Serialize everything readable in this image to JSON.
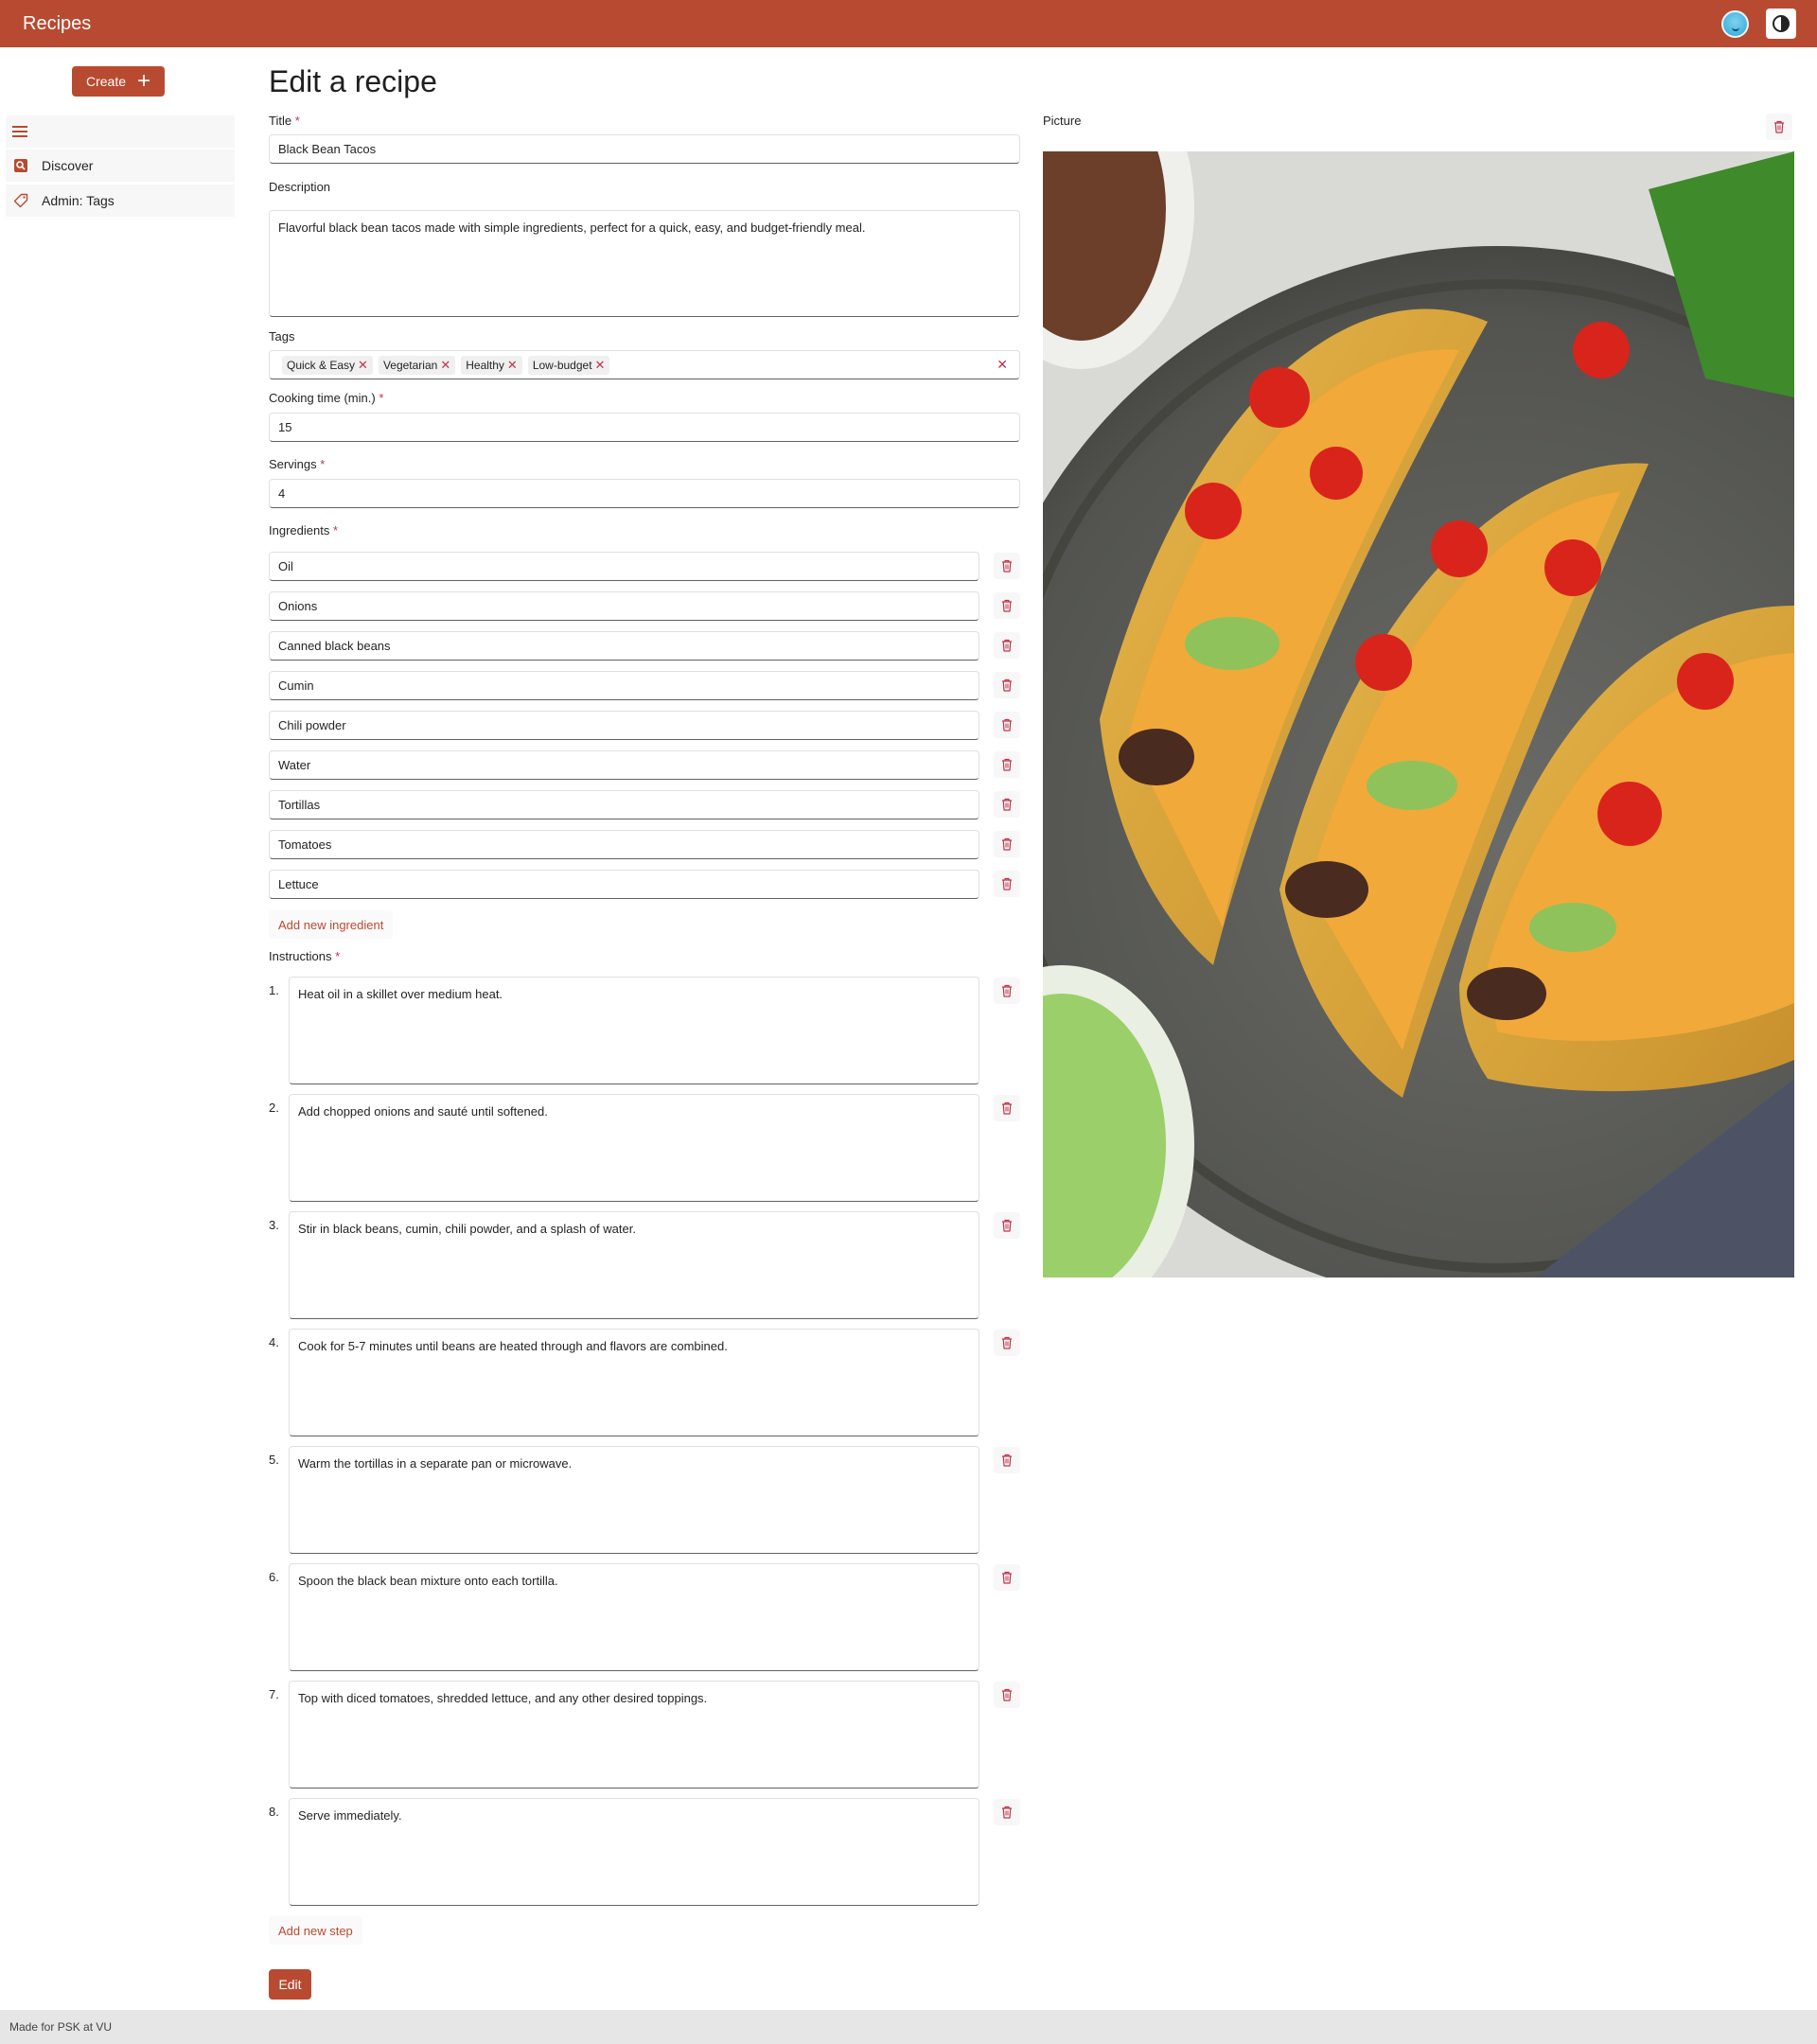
{
  "app": {
    "title": "Recipes"
  },
  "header": {
    "avatar_icon": "avatar-face-icon",
    "theme_icon": "contrast-icon"
  },
  "sidebar": {
    "create_label": "Create",
    "items": [
      {
        "label": "Discover",
        "icon": "search-icon"
      },
      {
        "label": "Admin: Tags",
        "icon": "tag-icon"
      }
    ]
  },
  "form": {
    "heading": "Edit a recipe",
    "title": {
      "label": "Title",
      "value": "Black Bean Tacos"
    },
    "description": {
      "label": "Description",
      "value": "Flavorful black bean tacos made with simple ingredients, perfect for a quick, easy, and budget-friendly meal."
    },
    "tags": {
      "label": "Tags",
      "values": [
        "Quick & Easy",
        "Vegetarian",
        "Healthy",
        "Low-budget"
      ]
    },
    "cooking_time": {
      "label": "Cooking time (min.)",
      "value": "15"
    },
    "servings": {
      "label": "Servings",
      "value": "4"
    },
    "ingredients": {
      "label": "Ingredients",
      "items": [
        "Oil",
        "Onions",
        "Canned black beans",
        "Cumin",
        "Chili powder",
        "Water",
        "Tortillas",
        "Tomatoes",
        "Lettuce"
      ],
      "add_label": "Add new ingredient"
    },
    "instructions": {
      "label": "Instructions",
      "steps": [
        {
          "num": "1.",
          "text": "Heat oil in a skillet over medium heat."
        },
        {
          "num": "2.",
          "text": "Add chopped onions and sauté until softened."
        },
        {
          "num": "3.",
          "text": "Stir in black beans, cumin, chili powder, and a splash of water."
        },
        {
          "num": "4.",
          "text": "Cook for 5-7 minutes until beans are heated through and flavors are combined."
        },
        {
          "num": "5.",
          "text": "Warm the tortillas in a separate pan or microwave."
        },
        {
          "num": "6.",
          "text": "Spoon the black bean mixture onto each tortilla."
        },
        {
          "num": "7.",
          "text": "Top with diced tomatoes, shredded lettuce, and any other desired toppings."
        },
        {
          "num": "8.",
          "text": "Serve immediately."
        }
      ],
      "add_label": "Add new step"
    },
    "submit_label": "Edit",
    "required_mark": "*"
  },
  "picture": {
    "label": "Picture"
  },
  "footer": {
    "text": "Made for PSK at VU"
  },
  "colors": {
    "accent": "#b84a31",
    "required": "#c4314b"
  }
}
